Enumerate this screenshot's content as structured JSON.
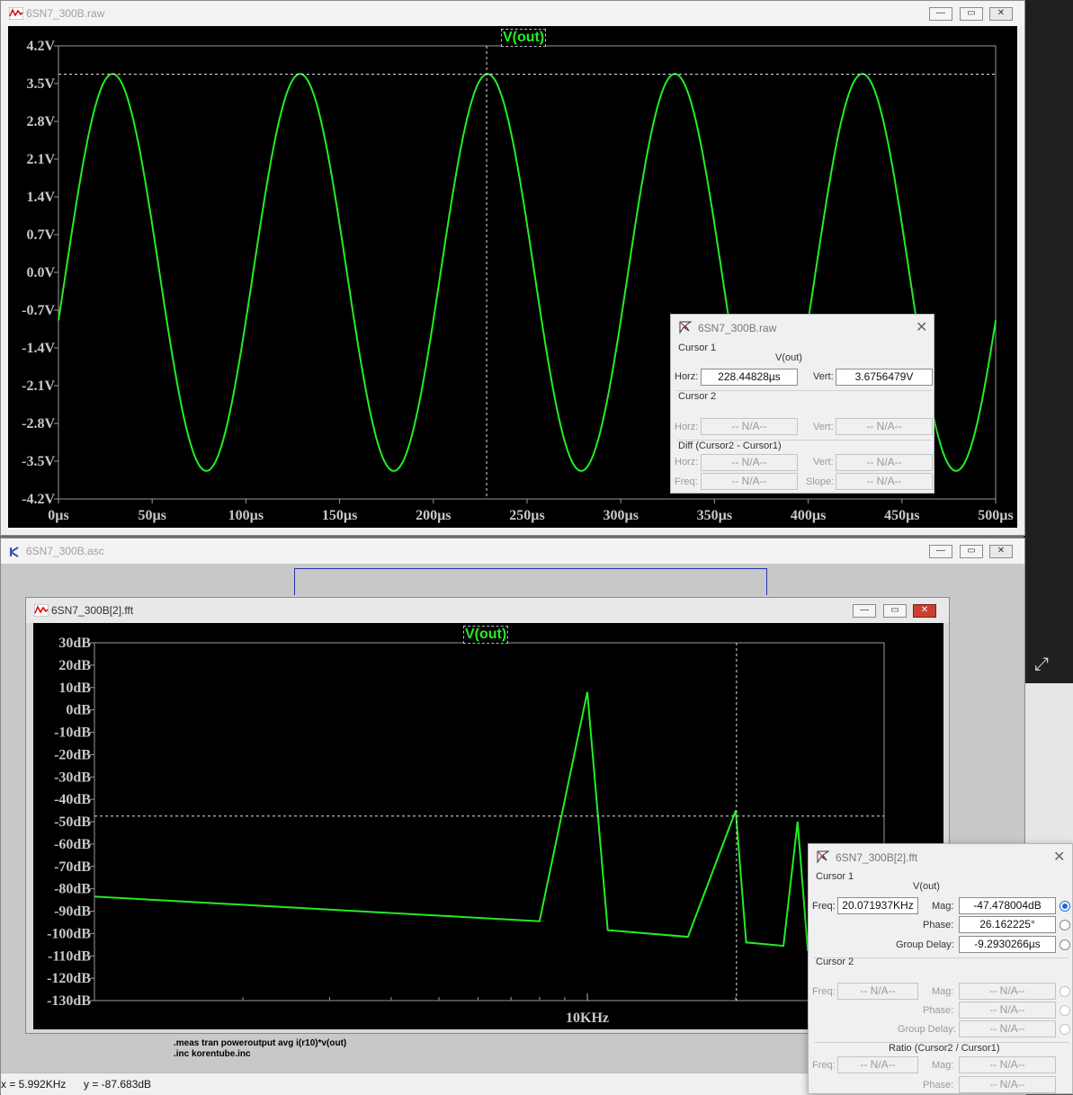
{
  "raw_window": {
    "title": "6SN7_300B.raw",
    "trace_label": "V(out)",
    "y_ticks": [
      "4.2V",
      "3.5V",
      "2.8V",
      "2.1V",
      "1.4V",
      "0.7V",
      "0.0V",
      "-0.7V",
      "-1.4V",
      "-2.1V",
      "-2.8V",
      "-3.5V",
      "-4.2V"
    ],
    "x_ticks": [
      "0µs",
      "50µs",
      "100µs",
      "150µs",
      "200µs",
      "250µs",
      "300µs",
      "350µs",
      "400µs",
      "450µs",
      "500µs"
    ],
    "buttons": {
      "minimize": "—",
      "maximize": "▭",
      "close": "✕"
    }
  },
  "asc_window": {
    "title": "6SN7_300B.asc",
    "directive_lines": [
      ".meas tran poweroutput avg i(r10)*v(out)",
      ".inc korentube.inc"
    ],
    "status_x": "x = 5.992KHz",
    "status_y": "y = -87.683dB",
    "buttons": {
      "minimize": "—",
      "maximize": "▭",
      "close": "✕"
    }
  },
  "fft_window": {
    "title": "6SN7_300B[2].fft",
    "trace_label": "V(out)",
    "y_ticks": [
      "30dB",
      "20dB",
      "10dB",
      "0dB",
      "-10dB",
      "-20dB",
      "-30dB",
      "-40dB",
      "-50dB",
      "-60dB",
      "-70dB",
      "-80dB",
      "-90dB",
      "-100dB",
      "-110dB",
      "-120dB",
      "-130dB"
    ],
    "x_tick": "10KHz",
    "buttons": {
      "minimize": "—",
      "maximize": "▭",
      "close": "✕"
    }
  },
  "raw_cursor_dialog": {
    "title": "6SN7_300B.raw",
    "cursor1_label": "Cursor 1",
    "trace": "V(out)",
    "horz_label": "Horz:",
    "horz_value": "228.44828µs",
    "vert_label": "Vert:",
    "vert_value": "3.6756479V",
    "cursor2_label": "Cursor 2",
    "c2_horz_label": "Horz:",
    "c2_horz": "-- N/A--",
    "c2_vert_label": "Vert:",
    "c2_vert": "-- N/A--",
    "diff_label": "Diff (Cursor2 - Cursor1)",
    "d_horz_label": "Horz:",
    "d_horz": "-- N/A--",
    "d_vert_label": "Vert:",
    "d_vert": "-- N/A--",
    "freq_label": "Freq:",
    "d_freq": "-- N/A--",
    "slope_label": "Slope:",
    "d_slope": "-- N/A--"
  },
  "fft_cursor_dialog": {
    "title": "6SN7_300B[2].fft",
    "cursor1_label": "Cursor 1",
    "trace": "V(out)",
    "freq_label": "Freq:",
    "freq_value": "20.071937KHz",
    "mag_label": "Mag:",
    "mag_value": "-47.478004dB",
    "phase_label": "Phase:",
    "phase_value": "26.162225°",
    "gd_label": "Group Delay:",
    "gd_value": "-9.2930266µs",
    "cursor2_label": "Cursor 2",
    "c2_freq_label": "Freq:",
    "c2_freq": "-- N/A--",
    "c2_mag_label": "Mag:",
    "c2_mag": "-- N/A--",
    "c2_phase_label": "Phase:",
    "c2_phase": "-- N/A--",
    "c2_gd_label": "Group Delay:",
    "c2_gd": "-- N/A--",
    "ratio_label": "Ratio (Cursor2 / Cursor1)",
    "r_freq_label": "Freq:",
    "r_freq": "-- N/A--",
    "r_mag_label": "Mag:",
    "r_mag": "-- N/A--",
    "r_phase_label": "Phase:",
    "r_phase": "-- N/A--"
  },
  "chart_data": [
    {
      "type": "line",
      "series": [
        {
          "name": "V(out)",
          "amplitude": 3.68,
          "frequency_khz": 10,
          "phase_deg": -14
        }
      ],
      "x_range_us": [
        0,
        500
      ],
      "ylim": [
        -4.2,
        4.2
      ],
      "cursor": {
        "x_us": 228.44828,
        "y_v": 3.6756479
      },
      "colors": {
        "trace": "#22ee22",
        "background": "#000000"
      }
    },
    {
      "type": "line",
      "series": [
        {
          "name": "V(out)",
          "points_khz_db": [
            [
              1,
              -83.5
            ],
            [
              8,
              -94.5
            ],
            [
              10,
              8
            ],
            [
              11,
              -98.5
            ],
            [
              16,
              -101.5
            ],
            [
              20,
              -45
            ],
            [
              21,
              -104
            ],
            [
              25,
              -105.5
            ],
            [
              26.7,
              -50
            ],
            [
              28,
              -107.5
            ],
            [
              30,
              -108
            ],
            [
              31.4,
              -75.5
            ],
            [
              32,
              -109.5
            ],
            [
              34,
              -110
            ],
            [
              34.8,
              -92
            ],
            [
              35.6,
              -111.5
            ],
            [
              37,
              -112
            ],
            [
              37.5,
              -106.5
            ],
            [
              38.3,
              -112.5
            ],
            [
              40,
              -113
            ]
          ]
        }
      ],
      "ylim": [
        -130,
        30
      ],
      "cursor": {
        "x_khz": 20.071937,
        "y_db": -47.478004
      },
      "colors": {
        "trace": "#22ee22",
        "background": "#000000"
      }
    }
  ]
}
